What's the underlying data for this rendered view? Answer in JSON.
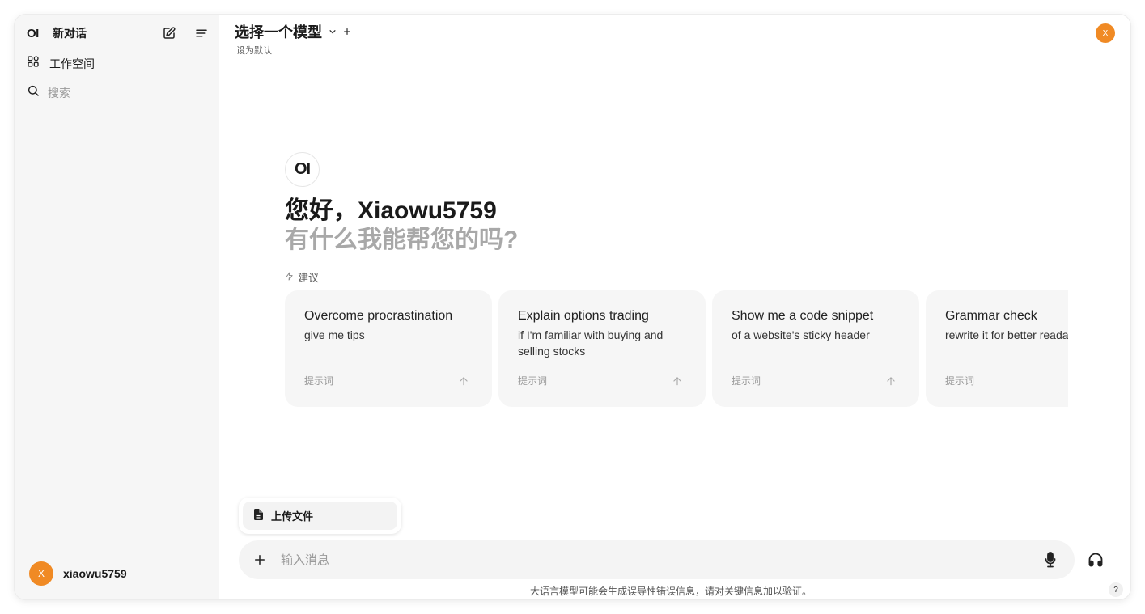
{
  "sidebar": {
    "logo": "OI",
    "new_chat_label": "新对话",
    "workspace_label": "工作空间",
    "search_placeholder": "搜索",
    "user": {
      "avatar_initial": "X",
      "name": "xiaowu5759"
    }
  },
  "header": {
    "model_selector_label": "选择一个模型",
    "set_default_label": "设为默认",
    "avatar_initial": "X"
  },
  "hero": {
    "logo": "OI",
    "greeting": "您好，Xiaowu5759",
    "subheading": "有什么我能帮您的吗?",
    "suggestions_label": "建议"
  },
  "suggestions": [
    {
      "title": "Overcome procrastination",
      "subtitle": "give me tips",
      "hint": "提示词"
    },
    {
      "title": "Explain options trading",
      "subtitle": "if I'm familiar with buying and selling stocks",
      "hint": "提示词"
    },
    {
      "title": "Show me a code snippet",
      "subtitle": "of a website's sticky header",
      "hint": "提示词"
    },
    {
      "title": "Grammar check",
      "subtitle": "rewrite it for better readability",
      "hint": "提示词"
    }
  ],
  "composer": {
    "upload_menu_item": "上传文件",
    "input_placeholder": "输入消息"
  },
  "footer": {
    "disclaimer": "大语言模型可能会生成误导性错误信息，请对关键信息加以验证。",
    "help": "?"
  },
  "colors": {
    "accent": "#f08a24",
    "sidebar_bg": "#f6f6f6",
    "card_bg": "#f6f6f6"
  }
}
